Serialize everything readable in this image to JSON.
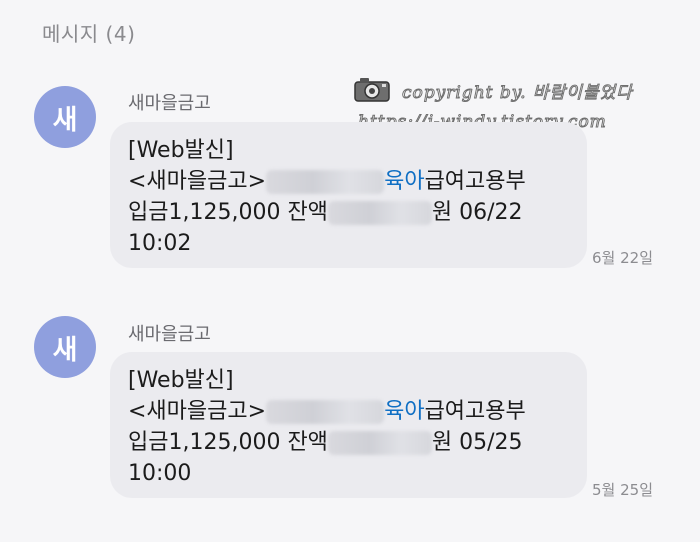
{
  "header": {
    "title": "메시지 (4)"
  },
  "watermark": {
    "line1": "copyright by. 바람이불었다",
    "line2": "https://j-windy.tistory.com",
    "icon": "camera-icon"
  },
  "messages": [
    {
      "avatar": "새",
      "sender": "새마을금고",
      "line1": "[Web발신]",
      "line2_prefix": "<새마을금고>",
      "line2_blue": "육아",
      "line2_suffix": "급여고용부",
      "line3_prefix": "입금1,125,000 잔액",
      "line3_suffix": "원 06/22",
      "line4": "10:02",
      "time": "6월 22일"
    },
    {
      "avatar": "새",
      "sender": "새마을금고",
      "line1": "[Web발신]",
      "line2_prefix": "<새마을금고>",
      "line2_blue": "육아",
      "line2_suffix": "급여고용부",
      "line3_prefix": "입금1,125,000 잔액",
      "line3_suffix": "원 05/25",
      "line4": "10:00",
      "time": "5월 25일"
    }
  ],
  "colors": {
    "background": "#f6f6f8",
    "bubble": "#ebebef",
    "avatar": "#8f9fde",
    "highlight": "#0f6fc4"
  }
}
